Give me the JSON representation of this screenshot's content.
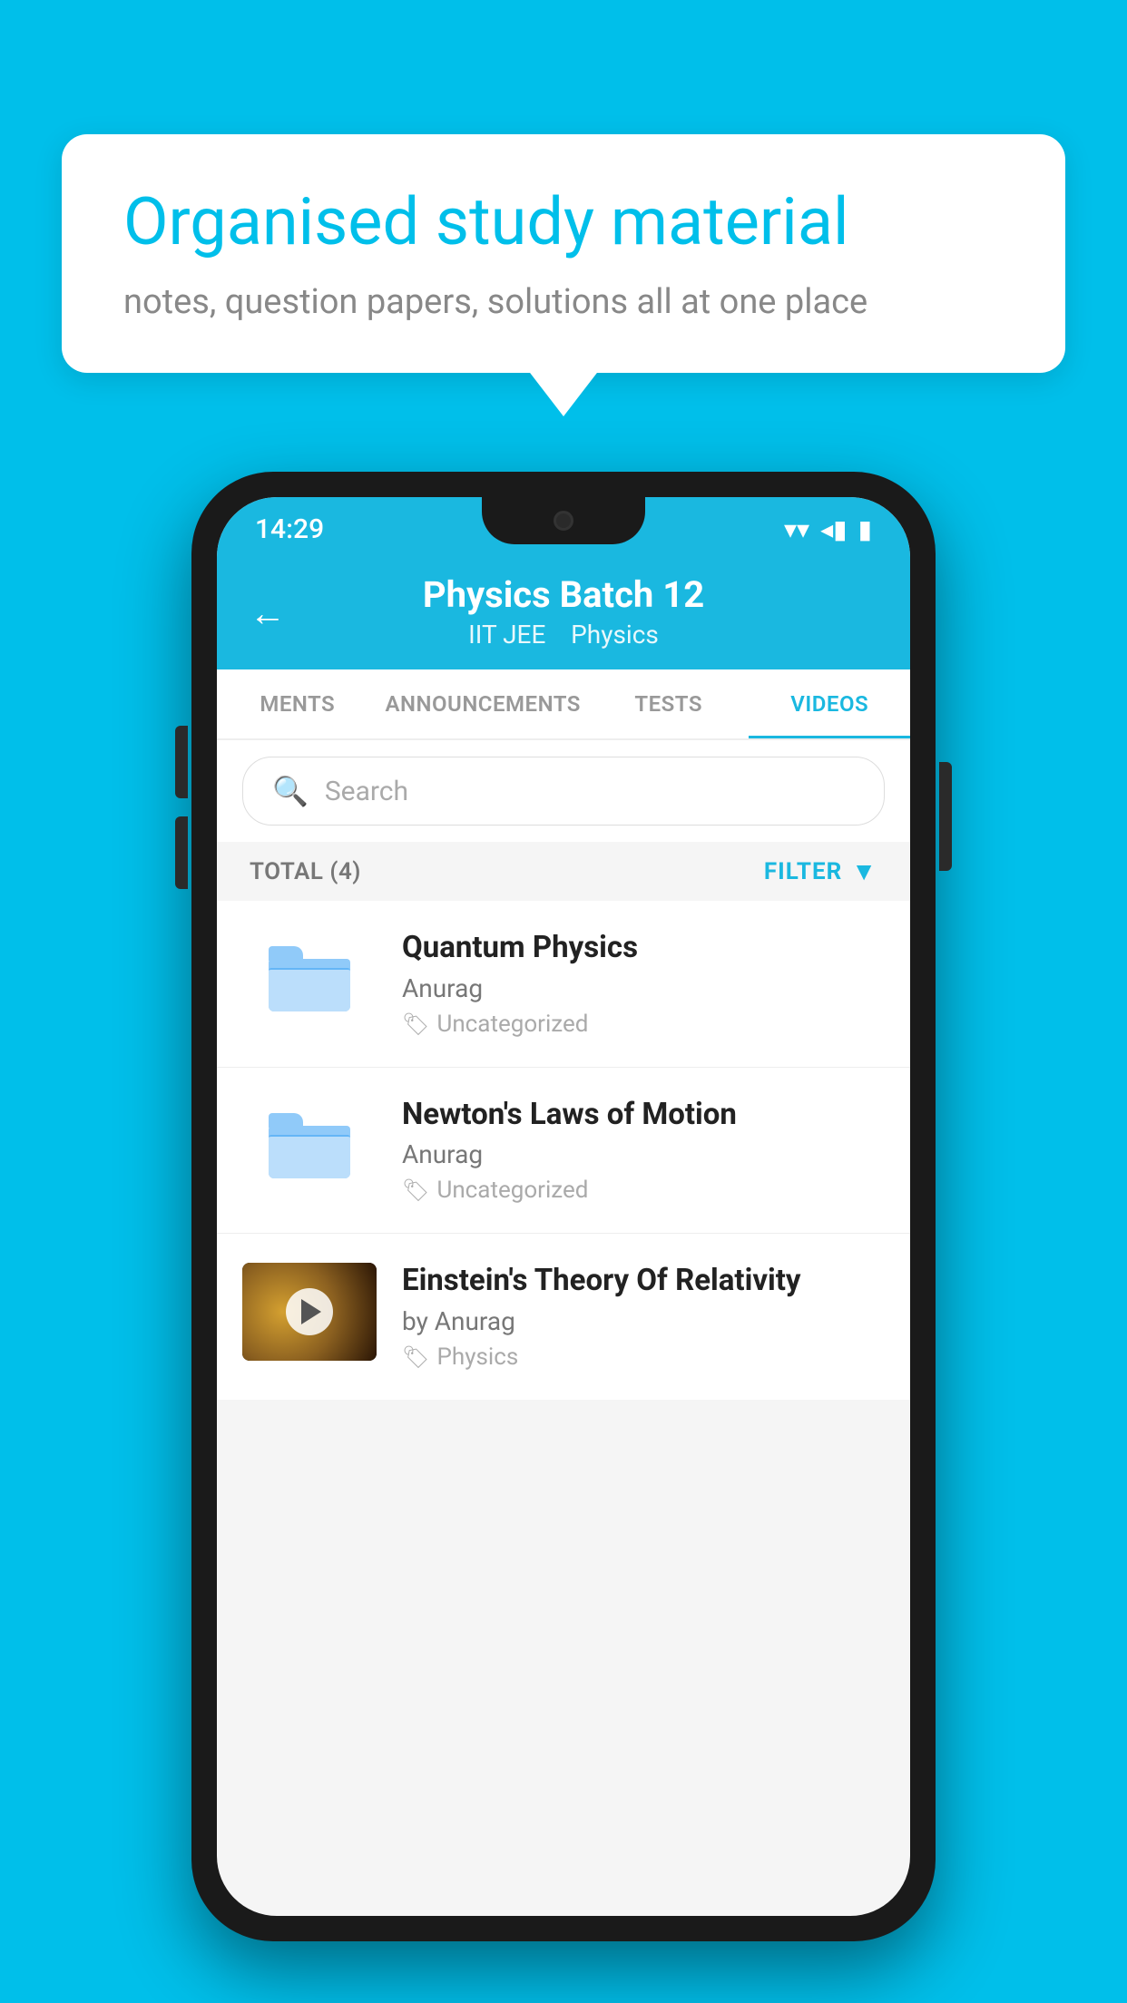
{
  "background": {
    "color": "#00BFEA"
  },
  "speech_bubble": {
    "title": "Organised study material",
    "subtitle": "notes, question papers, solutions all at one place"
  },
  "status_bar": {
    "time": "14:29",
    "wifi_icon": "▾",
    "signal_icon": "◂",
    "battery_icon": "▮"
  },
  "header": {
    "back_label": "←",
    "title": "Physics Batch 12",
    "subtitle_tag1": "IIT JEE",
    "subtitle_tag2": "Physics"
  },
  "tabs": [
    {
      "label": "MENTS",
      "active": false
    },
    {
      "label": "ANNOUNCEMENTS",
      "active": false
    },
    {
      "label": "TESTS",
      "active": false
    },
    {
      "label": "VIDEOS",
      "active": true
    }
  ],
  "search": {
    "placeholder": "Search"
  },
  "filter_bar": {
    "total_label": "TOTAL (4)",
    "filter_label": "FILTER"
  },
  "videos": [
    {
      "title": "Quantum Physics",
      "author": "Anurag",
      "tag": "Uncategorized",
      "has_thumbnail": false,
      "thumbnail_type": "folder"
    },
    {
      "title": "Newton's Laws of Motion",
      "author": "Anurag",
      "tag": "Uncategorized",
      "has_thumbnail": false,
      "thumbnail_type": "folder"
    },
    {
      "title": "Einstein's Theory Of Relativity",
      "author": "Anurag",
      "by_prefix": "by ",
      "tag": "Physics",
      "has_thumbnail": true,
      "thumbnail_type": "video"
    }
  ]
}
